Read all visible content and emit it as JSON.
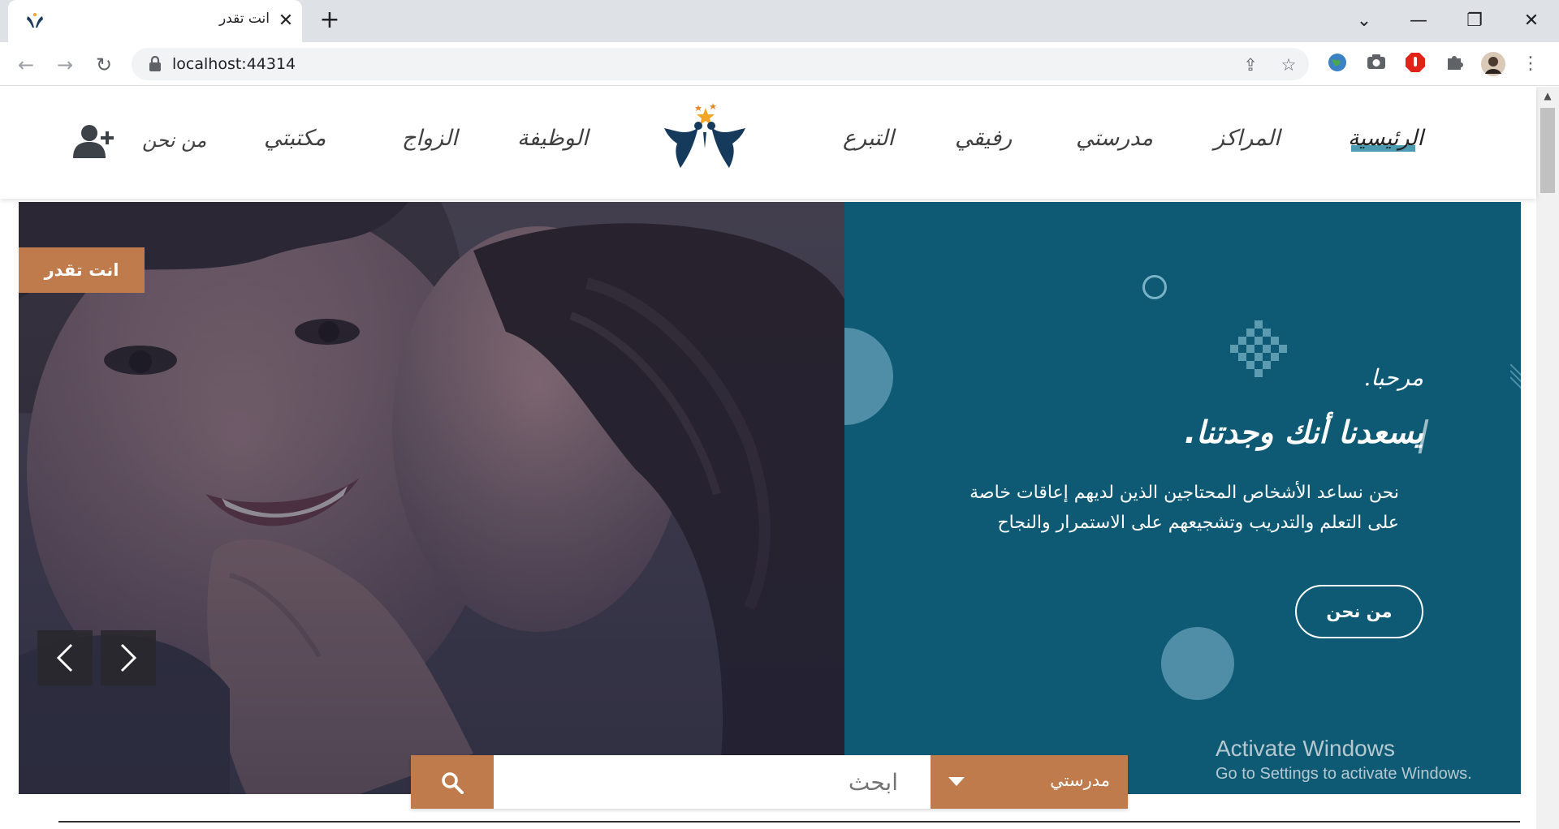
{
  "browser": {
    "tab_title": "انت تقدر",
    "url": "localhost:44314",
    "icons": [
      "back-icon",
      "forward-icon",
      "reload-icon",
      "lock-icon",
      "share-icon",
      "star-icon",
      "globe-extension-icon",
      "camera-extension-icon",
      "adblock-extension-icon",
      "puzzle-icon",
      "profile-avatar",
      "kebab-menu-icon"
    ]
  },
  "header": {
    "nav": [
      {
        "label": "الرئيسية",
        "active": true
      },
      {
        "label": "المراكز"
      },
      {
        "label": "مدرستي"
      },
      {
        "label": "رفيقي"
      },
      {
        "label": "التبرع"
      },
      {
        "label": "الوظيفة"
      },
      {
        "label": "الزواج"
      },
      {
        "label": "مكتبتي"
      },
      {
        "label": "من نحن"
      }
    ]
  },
  "hero": {
    "badge": "انت تقدر",
    "greeting": "مرحبا.",
    "headline": "يسعدنا أنك وجدتنا.",
    "description": "نحن نساعد الأشخاص المحتاجين الذين لديهم إعاقات خاصة على التعلم والتدريب وتشجيعهم على الاستمرار والنجاح",
    "about_button": "من نحن"
  },
  "search": {
    "placeholder": "ابحث",
    "category": "مدرستي"
  },
  "watermark": {
    "title": "Activate Windows",
    "subtitle": "Go to Settings to activate Windows."
  },
  "colors": {
    "accent": "#bf7b4c",
    "panel": "#0e5a74",
    "deco": "#4f8ea6",
    "active_nav": "#4b9cb3"
  }
}
